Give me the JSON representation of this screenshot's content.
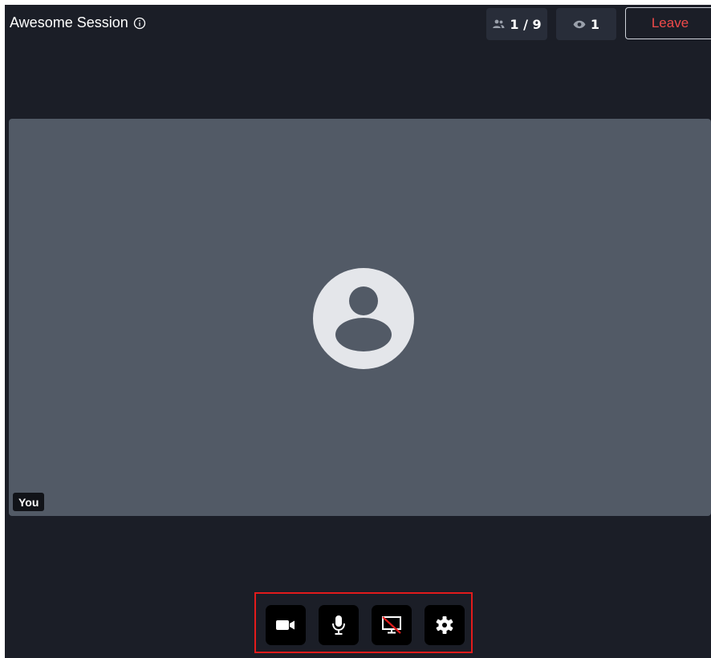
{
  "header": {
    "title": "Awesome Session",
    "participants": "1 / 9",
    "viewers": "1",
    "leave_label": "Leave"
  },
  "tile": {
    "name_label": "You"
  },
  "controls": {
    "items": [
      {
        "name": "camera",
        "icon": "video-camera-icon"
      },
      {
        "name": "microphone",
        "icon": "microphone-icon"
      },
      {
        "name": "screen-share",
        "icon": "screen-share-off-icon"
      },
      {
        "name": "settings",
        "icon": "gear-icon"
      }
    ]
  },
  "colors": {
    "background": "#1b1e27",
    "tile": "#525a66",
    "leave_text": "#f04a4a",
    "highlight_border": "#e21b1b"
  }
}
